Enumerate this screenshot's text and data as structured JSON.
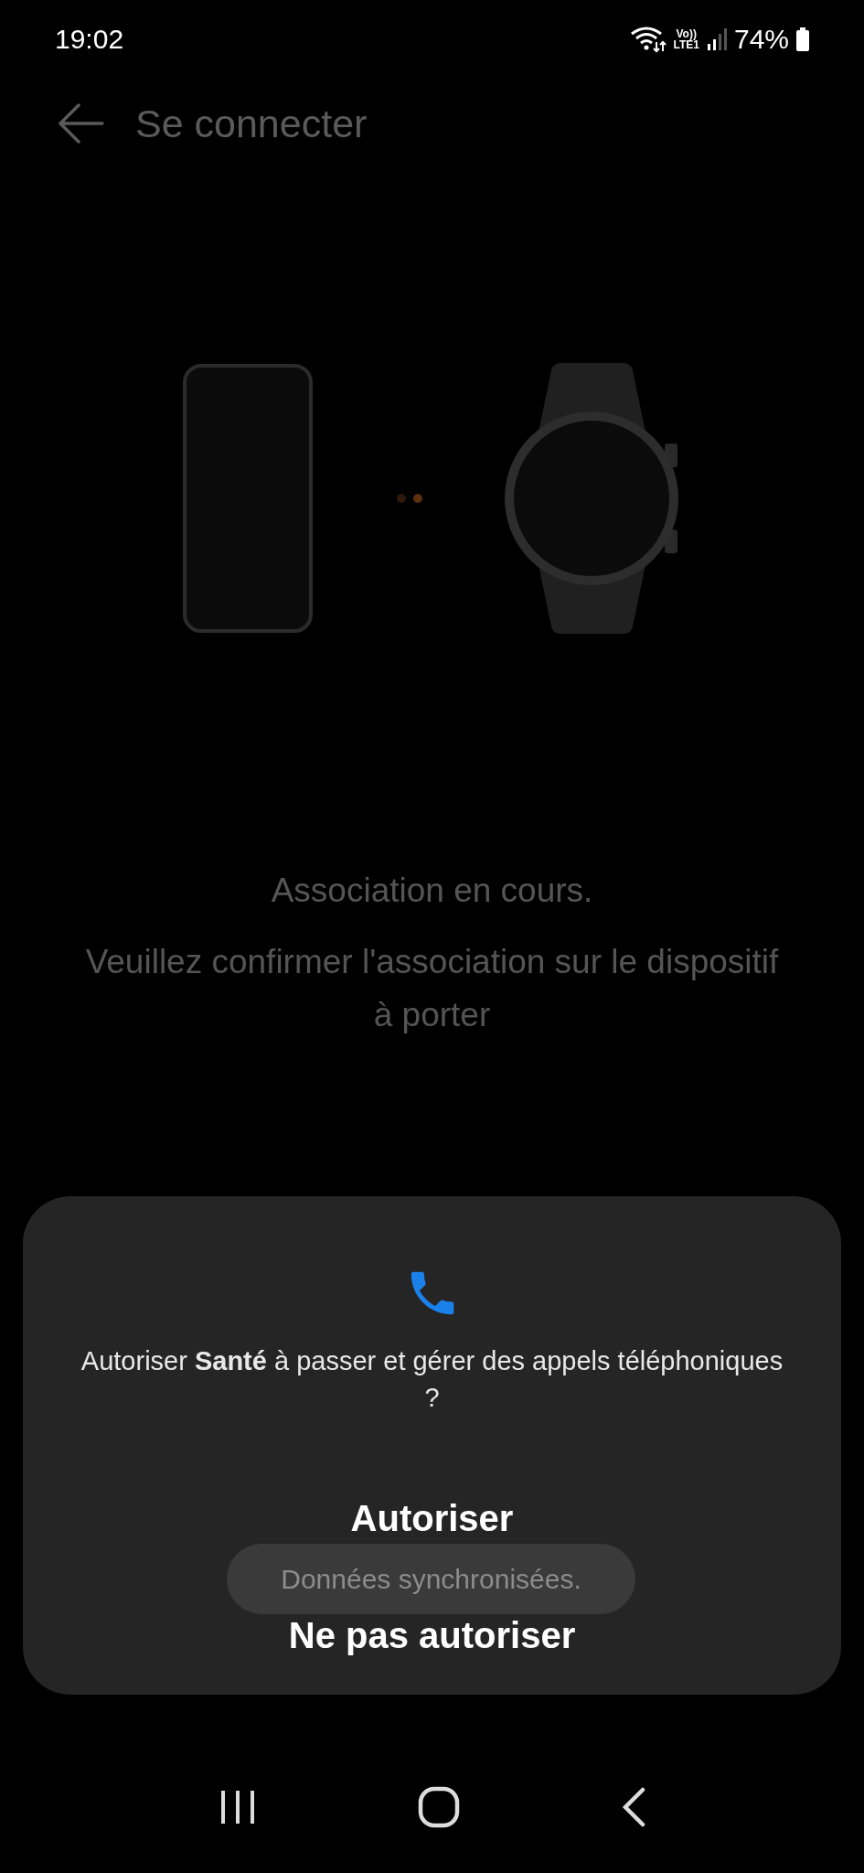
{
  "status_bar": {
    "time": "19:02",
    "volte": "Vo))",
    "sim": "LTE1",
    "battery": "74%"
  },
  "header": {
    "title": "Se connecter"
  },
  "pairing": {
    "dots": [
      {
        "color": "#2e1a0c"
      },
      {
        "color": "#5c2e0e"
      }
    ],
    "status": "Association en cours.",
    "instruction": "Veuillez confirmer l'association sur le dispositif à porter"
  },
  "dialog": {
    "message": "Autoriser **Santé** à passer et gérer des appels téléphoniques ?",
    "buttons": [
      "Autoriser",
      "Ne pas autoriser"
    ]
  },
  "toast": "Données synchronisées."
}
